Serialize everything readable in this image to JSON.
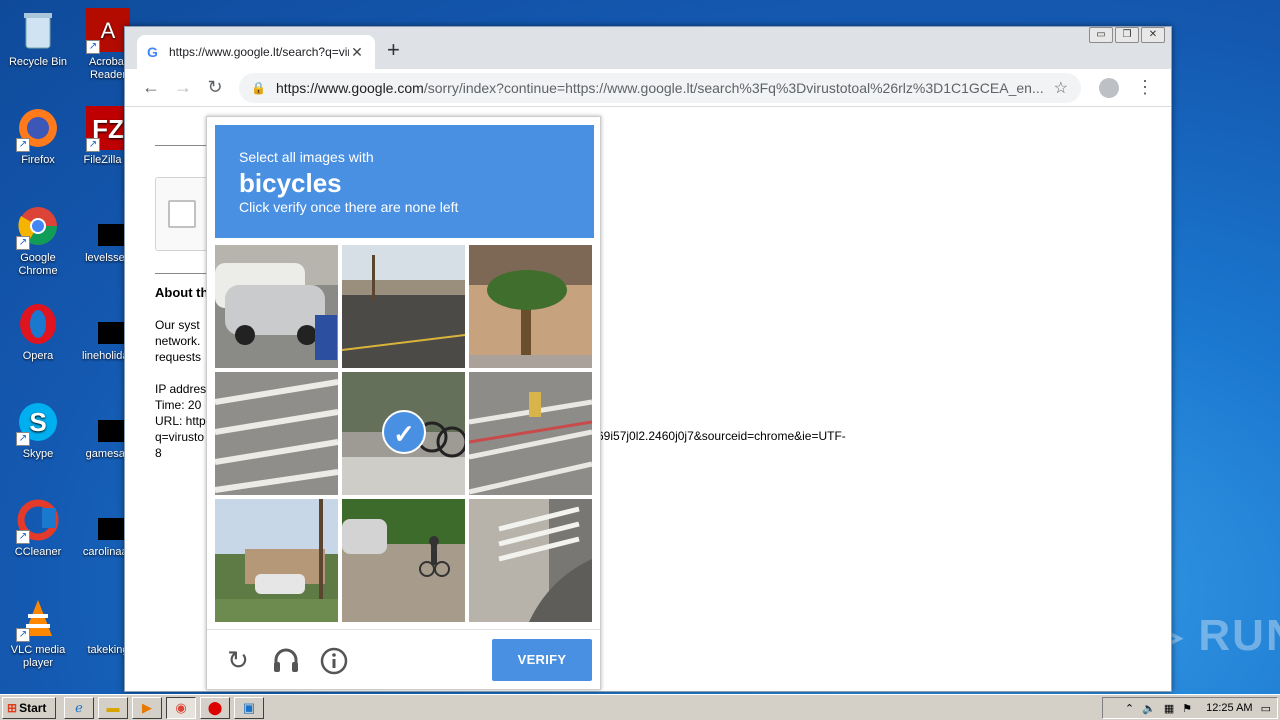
{
  "desktop": {
    "icons": [
      {
        "label": "Recycle Bin"
      },
      {
        "label": "Acrobat Reader"
      },
      {
        "label": "Firefox"
      },
      {
        "label": "FileZilla C"
      },
      {
        "label": "Google Chrome"
      },
      {
        "label": "levelssep"
      },
      {
        "label": "Opera"
      },
      {
        "label": "lineholiday"
      },
      {
        "label": "Skype"
      },
      {
        "label": "gamesav"
      },
      {
        "label": "CCleaner"
      },
      {
        "label": "carolinaas"
      },
      {
        "label": "VLC media player"
      },
      {
        "label": "takeking"
      }
    ],
    "watermark": "ANY ▷ RUN"
  },
  "browser": {
    "tab_title": "https://www.google.lt/search?q=vir",
    "url_host": "https://www.google.com",
    "url_rest": "/sorry/index?continue=https://www.google.lt/search%3Fq%3Dvirustotoal%26rlz%3D1C1GCEA_en...",
    "window_buttons": {
      "minimize": "▭",
      "restore": "❐",
      "close": "✕"
    }
  },
  "page": {
    "about_heading": "About th",
    "para1": [
      "Our syst",
      "network.",
      "requests"
    ],
    "para2": [
      "IP addres",
      "Time: 20",
      "URL: http",
      "q=virusto",
      "8"
    ],
    "url_tail": "69i57j0l2.2460j0j7&sourceid=chrome&ie=UTF-"
  },
  "captcha": {
    "instruction": "Select all images with",
    "target": "bicycles",
    "hint": "Click verify once there are none left",
    "verify_label": "VERIFY",
    "selected_tile": 4
  },
  "taskbar": {
    "start_label": "Start",
    "clock": "12:25 AM"
  }
}
